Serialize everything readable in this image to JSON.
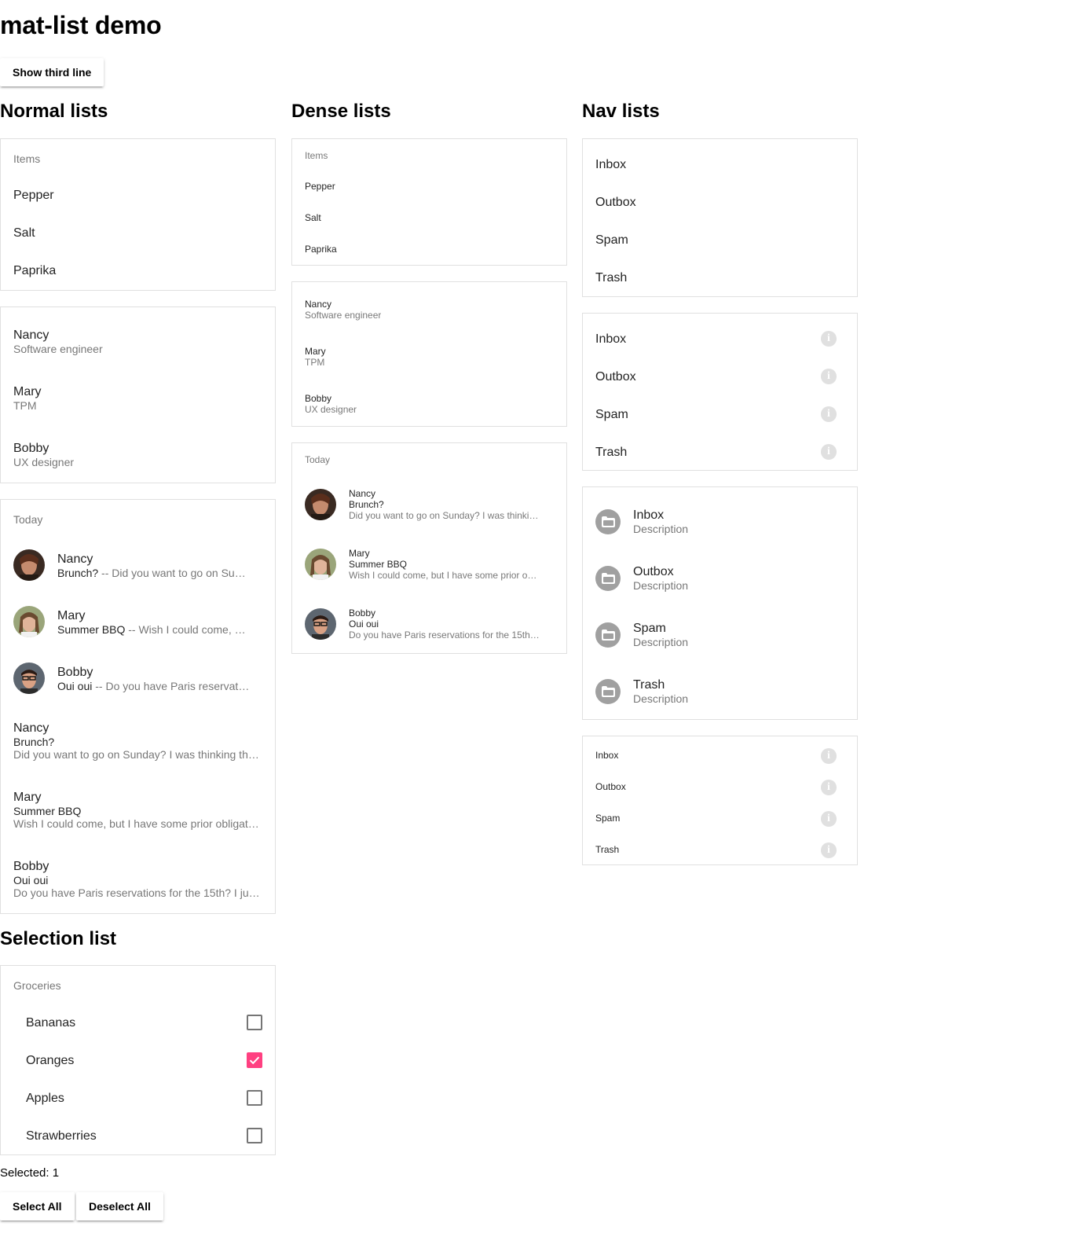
{
  "page": {
    "title": "mat-list demo",
    "toggle_button": "Show third line"
  },
  "sections": {
    "normal": "Normal lists",
    "dense": "Dense lists",
    "nav": "Nav lists",
    "selection": "Selection list"
  },
  "normal": {
    "items_list": {
      "subheader": "Items",
      "items": [
        "Pepper",
        "Salt",
        "Paprika"
      ]
    },
    "contacts": [
      {
        "name": "Nancy",
        "headline": "Software engineer"
      },
      {
        "name": "Mary",
        "headline": "TPM"
      },
      {
        "name": "Bobby",
        "headline": "UX designer"
      }
    ],
    "messages": {
      "subheader": "Today",
      "items": [
        {
          "from": "Nancy",
          "subject": "Brunch?",
          "snippet": " -- Did you want to go on Su…"
        },
        {
          "from": "Mary",
          "subject": "Summer BBQ",
          "snippet": " -- Wish I could come, …"
        },
        {
          "from": "Bobby",
          "subject": "Oui oui",
          "snippet": " -- Do you have Paris reservat…"
        }
      ]
    },
    "three_line": [
      {
        "from": "Nancy",
        "subject": "Brunch?",
        "message": "Did you want to go on Sunday? I was thinking th…"
      },
      {
        "from": "Mary",
        "subject": "Summer BBQ",
        "message": "Wish I could come, but I have some prior obligat…"
      },
      {
        "from": "Bobby",
        "subject": "Oui oui",
        "message": "Do you have Paris reservations for the 15th? I ju…"
      }
    ]
  },
  "dense": {
    "items_list": {
      "subheader": "Items",
      "items": [
        "Pepper",
        "Salt",
        "Paprika"
      ]
    },
    "contacts": [
      {
        "name": "Nancy",
        "headline": "Software engineer"
      },
      {
        "name": "Mary",
        "headline": "TPM"
      },
      {
        "name": "Bobby",
        "headline": "UX designer"
      }
    ],
    "messages": {
      "subheader": "Today",
      "items": [
        {
          "from": "Nancy",
          "subject": "Brunch?",
          "message": "Did you want to go on Sunday? I was thinki…"
        },
        {
          "from": "Mary",
          "subject": "Summer BBQ",
          "message": "Wish I could come, but I have some prior o…"
        },
        {
          "from": "Bobby",
          "subject": "Oui oui",
          "message": "Do you have Paris reservations for the 15th…"
        }
      ]
    }
  },
  "nav": {
    "links": [
      "Inbox",
      "Outbox",
      "Spam",
      "Trash"
    ],
    "links_with_info": [
      "Inbox",
      "Outbox",
      "Spam",
      "Trash"
    ],
    "folders": [
      {
        "name": "Inbox",
        "description": "Description"
      },
      {
        "name": "Outbox",
        "description": "Description"
      },
      {
        "name": "Spam",
        "description": "Description"
      },
      {
        "name": "Trash",
        "description": "Description"
      }
    ],
    "dense_links": [
      "Inbox",
      "Outbox",
      "Spam",
      "Trash"
    ],
    "info_icon": "info-icon",
    "folder_icon": "folder-icon"
  },
  "selection": {
    "subheader": "Groceries",
    "options": [
      {
        "label": "Bananas",
        "checked": false
      },
      {
        "label": "Oranges",
        "checked": true
      },
      {
        "label": "Apples",
        "checked": false
      },
      {
        "label": "Strawberries",
        "checked": false
      }
    ],
    "selected_label": "Selected: 1",
    "select_all": "Select All",
    "deselect_all": "Deselect All",
    "checkbox_color": "#ff4081"
  }
}
